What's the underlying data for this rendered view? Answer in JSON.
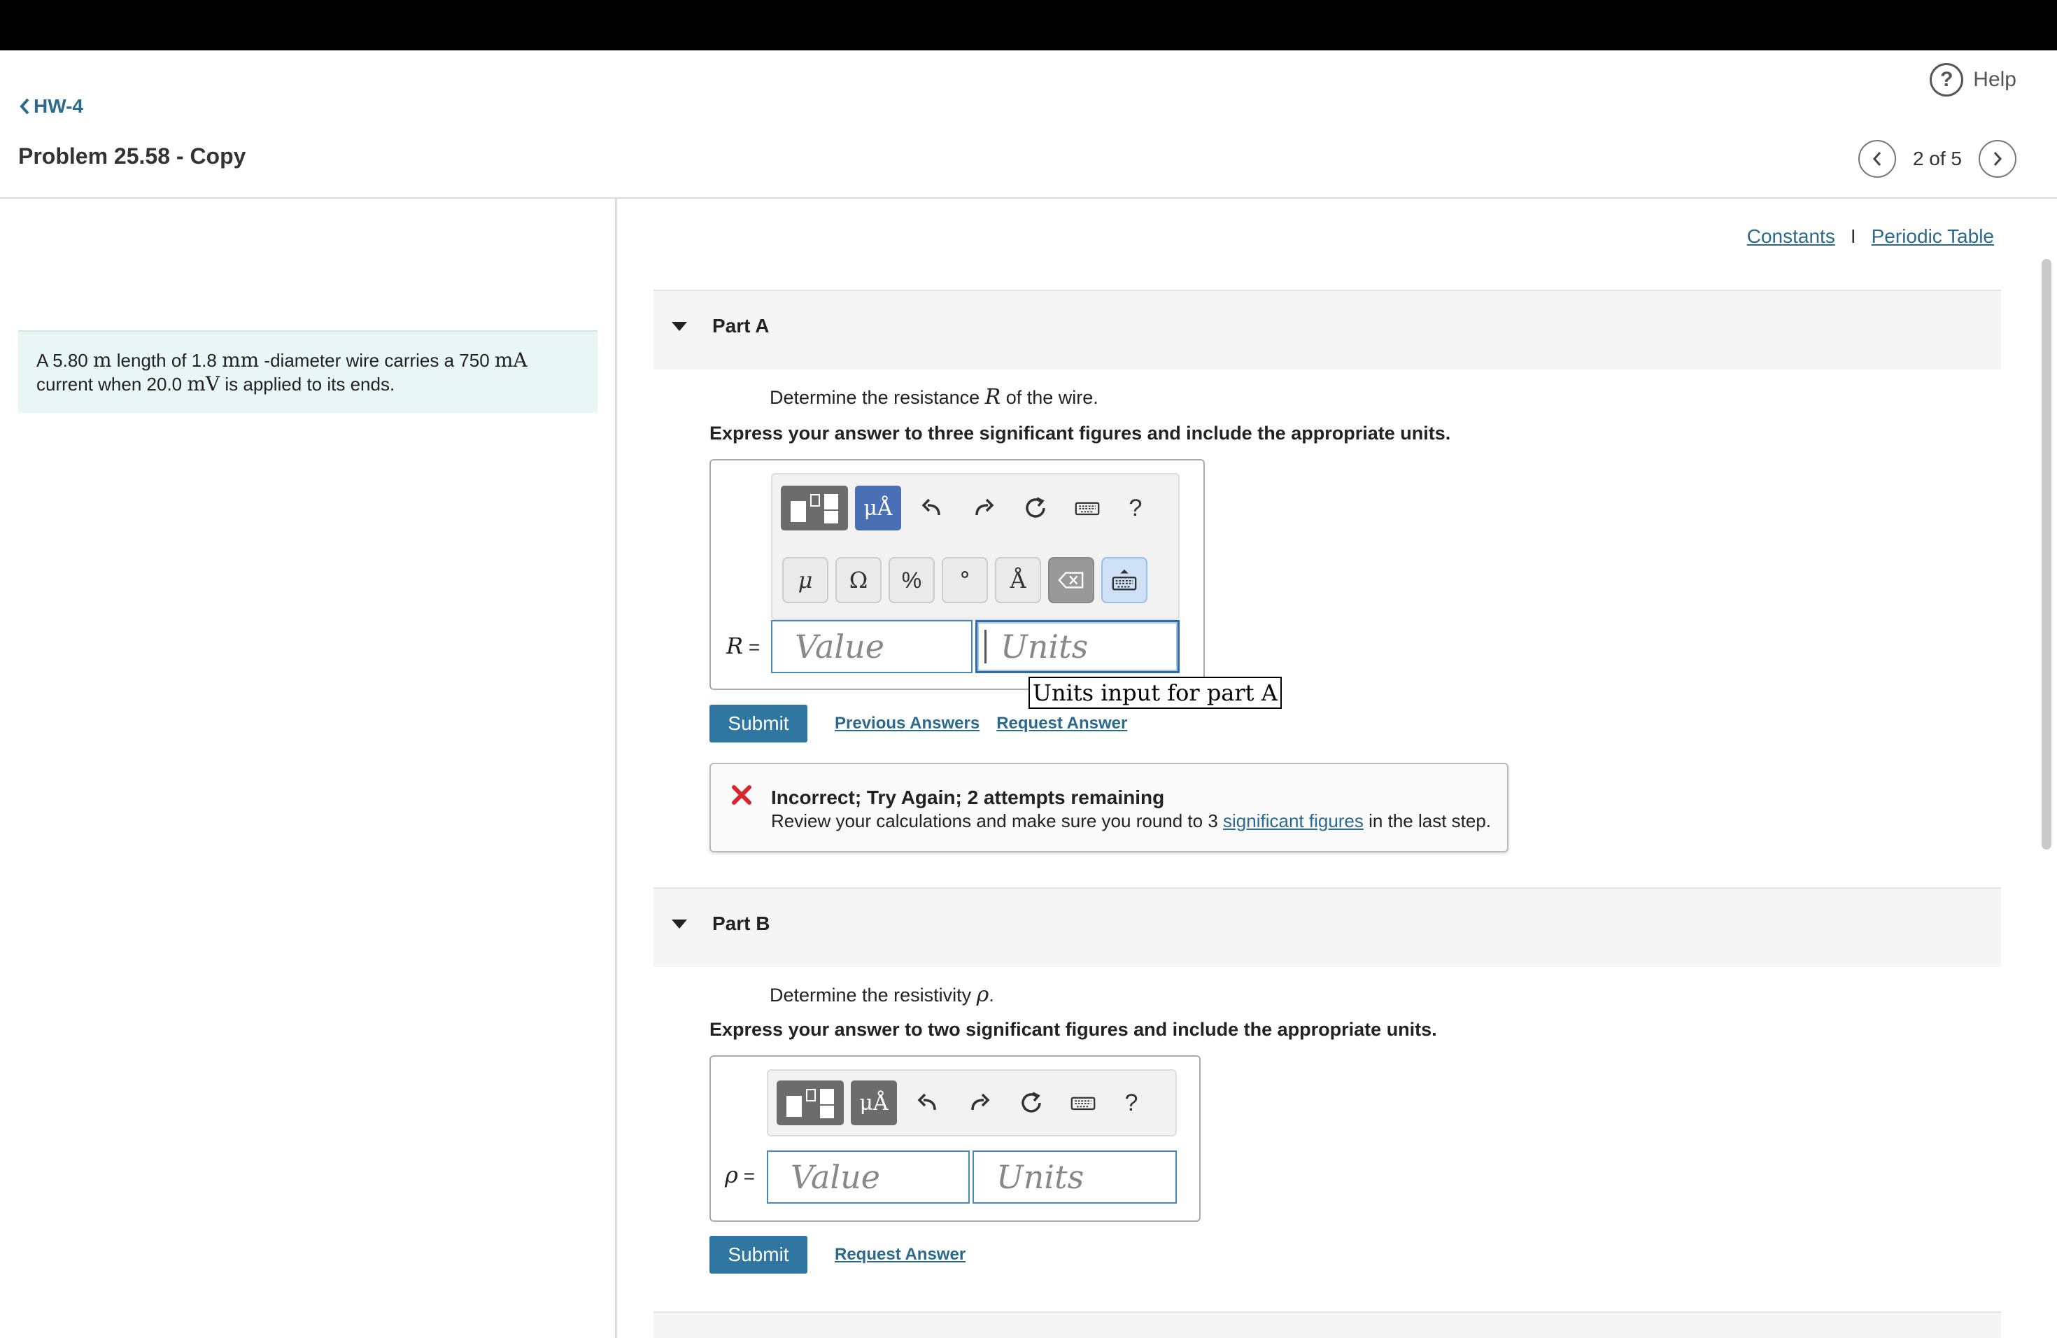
{
  "header": {
    "help_label": "Help",
    "help_glyph": "?",
    "back_label": "HW-4",
    "page_title": "Problem 25.58 - Copy",
    "pager_text": "2 of 5"
  },
  "problem": {
    "t1": "A 5.80 ",
    "m1": "m",
    "t2": " length of 1.8 ",
    "m2": "mm",
    "t3": " -diameter wire carries a 750 ",
    "m3": "mA",
    "t4": "current when 20.0 ",
    "m4": "mV",
    "t5": " is applied to its ends."
  },
  "links": {
    "constants": "Constants",
    "separator": "I",
    "periodic_table": "Periodic Table"
  },
  "toolbar": {
    "units_glyph": "μÅ",
    "help_glyph": "?",
    "symbols": [
      "μ",
      "Ω",
      "%",
      "°",
      "Å"
    ]
  },
  "part_a": {
    "label": "Part A",
    "question_pre": "Determine the resistance ",
    "question_var": "R",
    "question_post": " of the wire.",
    "instruction": "Express your answer to three significant figures and include the appropriate units.",
    "var_name": "R",
    "equals": " =",
    "value_placeholder": "Value",
    "units_placeholder": "Units",
    "tooltip": "Units input for part A",
    "submit_label": "Submit",
    "previous_answers": "Previous Answers",
    "request_answer": "Request Answer",
    "feedback": {
      "title": "Incorrect; Try Again; 2 attempts remaining",
      "msg_pre": "Review your calculations and make sure you round to 3 ",
      "msg_link": "significant figures",
      "msg_post": " in the last step."
    }
  },
  "part_b": {
    "label": "Part B",
    "question_pre": "Determine the resistivity ",
    "question_var": "ρ",
    "question_post": ".",
    "instruction": "Express your answer to two significant figures and include the appropriate units.",
    "var_name": "ρ",
    "equals": " =",
    "value_placeholder": "Value",
    "units_placeholder": "Units",
    "submit_label": "Submit",
    "request_answer": "Request Answer"
  },
  "colors": {
    "accent": "#2f77a0",
    "link": "#2b6a8c",
    "error": "#d9262c",
    "problem_bg": "#e9f6f6"
  }
}
